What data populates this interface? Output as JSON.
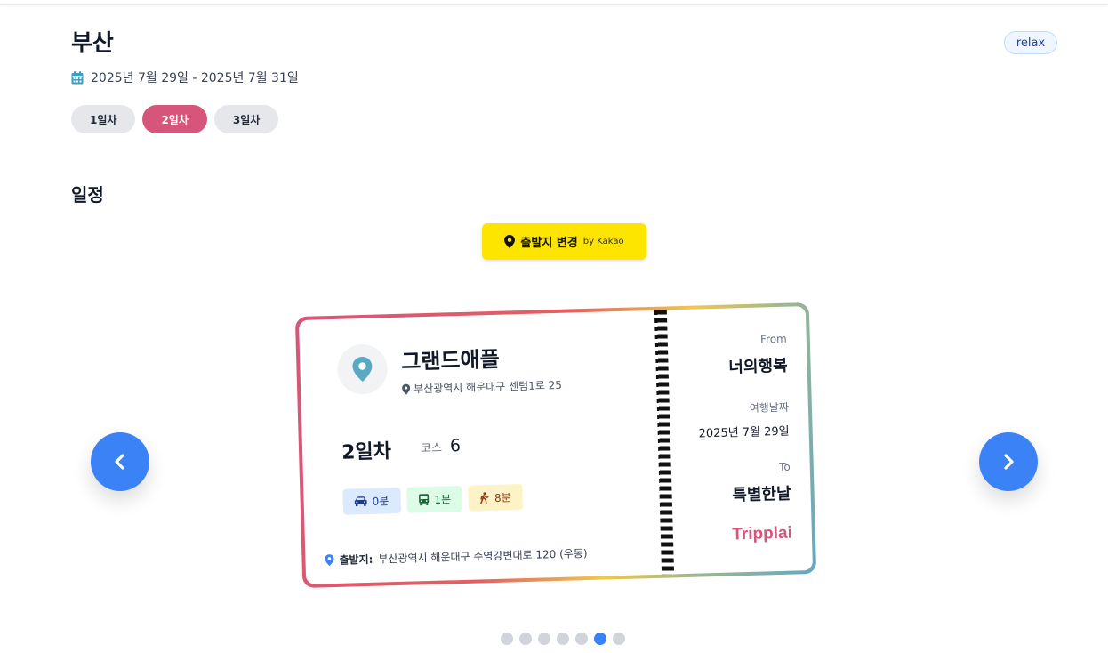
{
  "header": {
    "title": "부산",
    "mood_badge": "relax",
    "date_range": "2025년 7월 29일 - 2025년 7월 31일"
  },
  "day_tabs": [
    {
      "label": "1일차",
      "active": false
    },
    {
      "label": "2일차",
      "active": true
    },
    {
      "label": "3일차",
      "active": false
    }
  ],
  "section": {
    "title": "일정"
  },
  "kakao_button": {
    "label": "출발지 변경",
    "suffix": "by Kakao"
  },
  "ticket": {
    "place_name": "그랜드애플",
    "address": "부산광역시 해운대구 센텀1로 25",
    "day_label": "2일차",
    "course_label": "코스",
    "course_number": "6",
    "transport": {
      "car": "0분",
      "bus": "1분",
      "walk": "8분"
    },
    "origin_label": "출발지:",
    "origin_address": "부산광역시 해운대구 수영강변대로 120 (우동)",
    "from_label": "From",
    "from_value": "너의행복",
    "date_label": "여행날짜",
    "date_value": "2025년 7월 29일",
    "to_label": "To",
    "to_value": "특별한날",
    "brand": "Tripplai"
  },
  "pagination": {
    "total": 7,
    "active_index": 5
  },
  "colors": {
    "accent_pink": "#d6557a",
    "primary_blue": "#3b82f6",
    "kakao_yellow": "#fee500"
  }
}
